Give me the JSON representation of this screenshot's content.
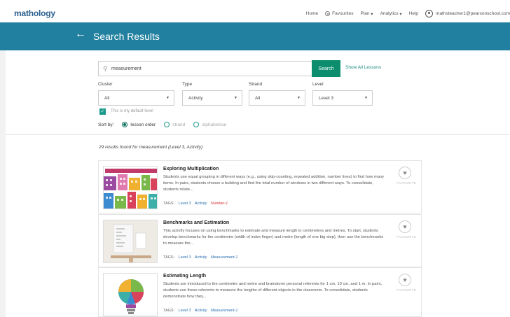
{
  "topbar": {
    "logo": "mathology",
    "nav": {
      "home": "Home",
      "favourites": "Favourites",
      "plan": "Plan",
      "analytics": "Analytics",
      "help": "Help",
      "user": "mathsteacher1@pearsonschool.com"
    }
  },
  "header": {
    "back": "←",
    "title": "Search Results"
  },
  "search": {
    "value": "measurement",
    "button": "Search",
    "show_all": "Show All Lessons"
  },
  "filters": {
    "cluster": {
      "label": "Cluster",
      "value": "All"
    },
    "type": {
      "label": "Type",
      "value": "Activity"
    },
    "strand": {
      "label": "Strand",
      "value": "All"
    },
    "level": {
      "label": "Level",
      "value": "Level 3"
    }
  },
  "default_level": {
    "label": "This is my default level",
    "checked": true
  },
  "sort": {
    "label": "Sort by:",
    "options": [
      "lesson order",
      "strand",
      "alphabetical"
    ],
    "selected": "lesson order"
  },
  "results_count": "29 results found for measurement (Level 3, Activity)",
  "results": [
    {
      "title": "Exploring Multiplication",
      "description": "Students use equal grouping in different ways (e.g., using skip-counting, repeated addition, number lines) to find how many items. In pairs, students choose a building and find the total number of windows in two different ways. To consolidate, students relate...",
      "tags_label": "TAGS:",
      "tags": [
        "Level 3",
        "Activity",
        "Number-1"
      ],
      "favourite": "FAVOURITE"
    },
    {
      "title": "Benchmarks and Estimation",
      "description": "This activity focuses on using benchmarks to estimate and measure length in centimetres and metres. To start, students develop benchmarks for the centimetre (width of index finger) and metre (length of one big step), then use the benchmarks to measure the...",
      "tags_label": "TAGS:",
      "tags": [
        "Level 3",
        "Activity",
        "Measurement-1"
      ],
      "favourite": "FAVOURITE"
    },
    {
      "title": "Estimating Length",
      "description": "Students are introduced to the centimetre and metre and brainstorm personal referents for 1 cm, 10 cm, and 1 m. In pairs, students use these referents to measure the lengths of different objects in the classroom. To consolidate, students demonstrate how they...",
      "tags_label": "TAGS:",
      "tags": [
        "Level 3",
        "Activity",
        "Measurement-1"
      ],
      "favourite": "FAVOURITE"
    }
  ],
  "colors": {
    "header": "#2180a0",
    "search_button": "#0c8e6e",
    "tag": "#2a6fb0",
    "tag_number": "#d03030"
  }
}
